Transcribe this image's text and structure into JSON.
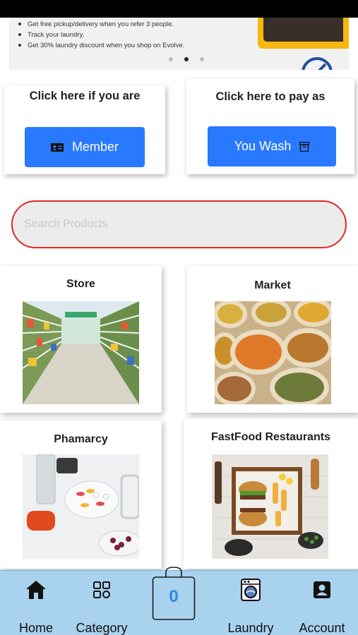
{
  "banner": {
    "bullets": [
      "Get free pickup/delivery when you refer 3 people.",
      "Track your laundry.",
      "Get 30% laundry discount when you shop on Evolve."
    ],
    "carousel": {
      "count": 3,
      "active_index": 1
    }
  },
  "member_card": {
    "title": "Click here if you are",
    "button_label": "Member",
    "button_icon": "id-card-icon"
  },
  "youwash_card": {
    "title": "Click here to pay as",
    "button_label": "You Wash",
    "button_icon": "archive-box-icon"
  },
  "search": {
    "placeholder": "Search Products",
    "value": ""
  },
  "categories": [
    {
      "title": "Store",
      "image": "supermarket-aisle"
    },
    {
      "title": "Market",
      "image": "grain-sacks"
    },
    {
      "title": "Phamarcy",
      "image": "pills-on-table"
    },
    {
      "title": "FastFood Restaurants",
      "image": "burger-platter"
    }
  ],
  "tabbar": {
    "home_label": "Home",
    "category_label": "Category",
    "cart_count": "0",
    "laundry_label": "Laundry",
    "account_label": "Account"
  },
  "colors": {
    "accent": "#2979ff",
    "tabbar": "#a9d2ef",
    "search_border": "#e02828",
    "cart_count": "#2c8be0"
  }
}
